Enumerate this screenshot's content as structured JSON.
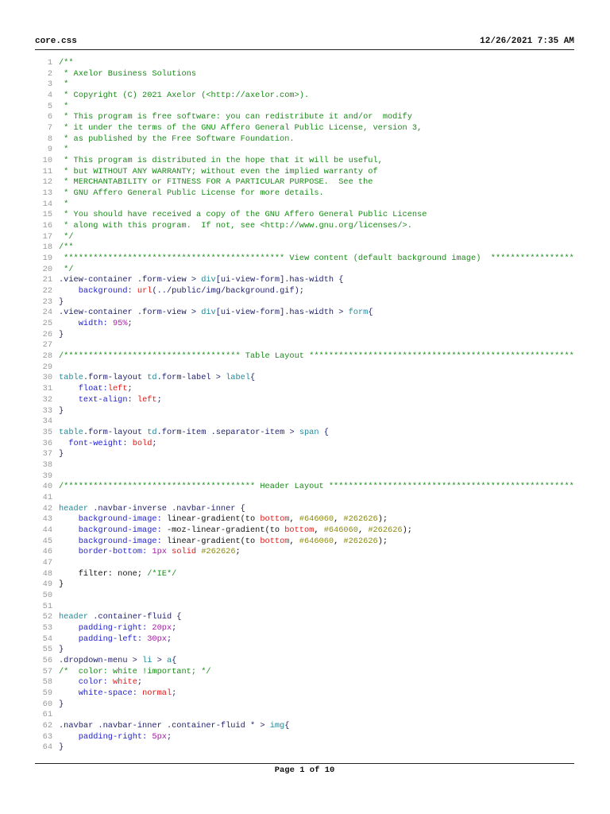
{
  "header": {
    "filename": "core.css",
    "datetime": "12/26/2021 7:35 AM"
  },
  "footer": {
    "page": "Page 1 of 10"
  },
  "lines": [
    [
      [
        "c",
        "/**"
      ]
    ],
    [
      [
        "c",
        " * Axelor Business Solutions"
      ]
    ],
    [
      [
        "c",
        " *"
      ]
    ],
    [
      [
        "c",
        " * Copyright (C) 2021 Axelor (<http://axelor.com>)."
      ]
    ],
    [
      [
        "c",
        " *"
      ]
    ],
    [
      [
        "c",
        " * This program is free software: you can redistribute it and/or  modify"
      ]
    ],
    [
      [
        "c",
        " * it under the terms of the GNU Affero General Public License, version 3,"
      ]
    ],
    [
      [
        "c",
        " * as published by the Free Software Foundation."
      ]
    ],
    [
      [
        "c",
        " *"
      ]
    ],
    [
      [
        "c",
        " * This program is distributed in the hope that it will be useful,"
      ]
    ],
    [
      [
        "c",
        " * but WITHOUT ANY WARRANTY; without even the implied warranty of"
      ]
    ],
    [
      [
        "c",
        " * MERCHANTABILITY or FITNESS FOR A PARTICULAR PURPOSE.  See the"
      ]
    ],
    [
      [
        "c",
        " * GNU Affero General Public License for more details."
      ]
    ],
    [
      [
        "c",
        " *"
      ]
    ],
    [
      [
        "c",
        " * You should have received a copy of the GNU Affero General Public License"
      ]
    ],
    [
      [
        "c",
        " * along with this program.  If not, see <http://www.gnu.org/licenses/>."
      ]
    ],
    [
      [
        "c",
        " */"
      ]
    ],
    [
      [
        "c",
        "/**"
      ]
    ],
    [
      [
        "c",
        " ********************************************* View content (default background image)  ************************************"
      ]
    ],
    [
      [
        "c",
        " */"
      ]
    ],
    [
      [
        "s",
        ".view-container .form-view > "
      ],
      [
        "t",
        "div"
      ],
      [
        "s",
        "[ui-view-form].has-width {"
      ]
    ],
    [
      [
        "x",
        "    "
      ],
      [
        "p",
        "background:"
      ],
      [
        "x",
        " "
      ],
      [
        "v",
        "url"
      ],
      [
        "s",
        "(../public/img/background.gif);"
      ]
    ],
    [
      [
        "s",
        "}"
      ]
    ],
    [
      [
        "s",
        ".view-container .form-view > "
      ],
      [
        "t",
        "div"
      ],
      [
        "s",
        "[ui-view-form].has-width > "
      ],
      [
        "t",
        "form"
      ],
      [
        "s",
        "{"
      ]
    ],
    [
      [
        "x",
        "    "
      ],
      [
        "p",
        "width:"
      ],
      [
        "x",
        " "
      ],
      [
        "n",
        "95%"
      ],
      [
        "s",
        ";"
      ]
    ],
    [
      [
        "s",
        "}"
      ]
    ],
    [],
    [
      [
        "c",
        "/************************************ Table Layout ***************************************************************************"
      ]
    ],
    [],
    [
      [
        "t",
        "table"
      ],
      [
        "s",
        ".form-layout "
      ],
      [
        "t",
        "td"
      ],
      [
        "s",
        ".form-label > "
      ],
      [
        "t",
        "label"
      ],
      [
        "s",
        "{"
      ]
    ],
    [
      [
        "x",
        "    "
      ],
      [
        "p",
        "float:"
      ],
      [
        "v",
        "left"
      ],
      [
        "s",
        ";"
      ]
    ],
    [
      [
        "x",
        "    "
      ],
      [
        "p",
        "text-align:"
      ],
      [
        "x",
        " "
      ],
      [
        "v",
        "left"
      ],
      [
        "s",
        ";"
      ]
    ],
    [
      [
        "s",
        "}"
      ]
    ],
    [],
    [
      [
        "t",
        "table"
      ],
      [
        "s",
        ".form-layout "
      ],
      [
        "t",
        "td"
      ],
      [
        "s",
        ".form-item .separator-item > "
      ],
      [
        "t",
        "span"
      ],
      [
        "s",
        " {"
      ]
    ],
    [
      [
        "x",
        "  "
      ],
      [
        "p",
        "font-weight:"
      ],
      [
        "x",
        " "
      ],
      [
        "v",
        "bold"
      ],
      [
        "s",
        ";"
      ]
    ],
    [
      [
        "s",
        "}"
      ]
    ],
    [],
    [],
    [
      [
        "c",
        "/*************************************** Header Layout ************************************************************************"
      ]
    ],
    [],
    [
      [
        "t",
        "header"
      ],
      [
        "s",
        " .navbar-inverse .navbar-inner {"
      ]
    ],
    [
      [
        "x",
        "    "
      ],
      [
        "p",
        "background-image:"
      ],
      [
        "x",
        " linear-gradient(to "
      ],
      [
        "v",
        "bottom"
      ],
      [
        "x",
        ", "
      ],
      [
        "h",
        "#646060"
      ],
      [
        "x",
        ", "
      ],
      [
        "h",
        "#262626"
      ],
      [
        "x",
        ");"
      ]
    ],
    [
      [
        "x",
        "    "
      ],
      [
        "p",
        "background-image:"
      ],
      [
        "x",
        " -moz-linear-gradient(to "
      ],
      [
        "v",
        "bottom"
      ],
      [
        "x",
        ", "
      ],
      [
        "h",
        "#646060"
      ],
      [
        "x",
        ", "
      ],
      [
        "h",
        "#262626"
      ],
      [
        "x",
        ");"
      ]
    ],
    [
      [
        "x",
        "    "
      ],
      [
        "p",
        "background-image:"
      ],
      [
        "x",
        " linear-gradient(to "
      ],
      [
        "v",
        "bottom"
      ],
      [
        "x",
        ", "
      ],
      [
        "h",
        "#646060"
      ],
      [
        "x",
        ", "
      ],
      [
        "h",
        "#262626"
      ],
      [
        "x",
        ");"
      ]
    ],
    [
      [
        "x",
        "    "
      ],
      [
        "p",
        "border-bottom:"
      ],
      [
        "x",
        " "
      ],
      [
        "n",
        "1px"
      ],
      [
        "x",
        " "
      ],
      [
        "v",
        "solid"
      ],
      [
        "x",
        " "
      ],
      [
        "h",
        "#262626"
      ],
      [
        "x",
        ";"
      ]
    ],
    [],
    [
      [
        "x",
        "    filter: none; "
      ],
      [
        "c",
        "/*IE*/"
      ]
    ],
    [
      [
        "x",
        "}"
      ]
    ],
    [],
    [],
    [
      [
        "t",
        "header"
      ],
      [
        "s",
        " .container-fluid {"
      ]
    ],
    [
      [
        "x",
        "    "
      ],
      [
        "p",
        "padding-right:"
      ],
      [
        "x",
        " "
      ],
      [
        "n",
        "20px"
      ],
      [
        "s",
        ";"
      ]
    ],
    [
      [
        "x",
        "    "
      ],
      [
        "p",
        "padding-left:"
      ],
      [
        "x",
        " "
      ],
      [
        "n",
        "30px"
      ],
      [
        "s",
        ";"
      ]
    ],
    [
      [
        "s",
        "}"
      ]
    ],
    [
      [
        "s",
        ".dropdown-menu > "
      ],
      [
        "t",
        "li"
      ],
      [
        "s",
        " > "
      ],
      [
        "t",
        "a"
      ],
      [
        "s",
        "{"
      ]
    ],
    [
      [
        "c",
        "/*  color: white !important; */"
      ]
    ],
    [
      [
        "x",
        "    "
      ],
      [
        "p",
        "color:"
      ],
      [
        "x",
        " "
      ],
      [
        "v",
        "white"
      ],
      [
        "s",
        ";"
      ]
    ],
    [
      [
        "x",
        "    "
      ],
      [
        "p",
        "white-space:"
      ],
      [
        "x",
        " "
      ],
      [
        "v",
        "normal"
      ],
      [
        "s",
        ";"
      ]
    ],
    [
      [
        "s",
        "}"
      ]
    ],
    [],
    [
      [
        "s",
        ".navbar .navbar-inner .container-fluid * > "
      ],
      [
        "t",
        "img"
      ],
      [
        "s",
        "{"
      ]
    ],
    [
      [
        "x",
        "    "
      ],
      [
        "p",
        "padding-right:"
      ],
      [
        "x",
        " "
      ],
      [
        "n",
        "5px"
      ],
      [
        "s",
        ";"
      ]
    ],
    [
      [
        "s",
        "}"
      ]
    ]
  ]
}
